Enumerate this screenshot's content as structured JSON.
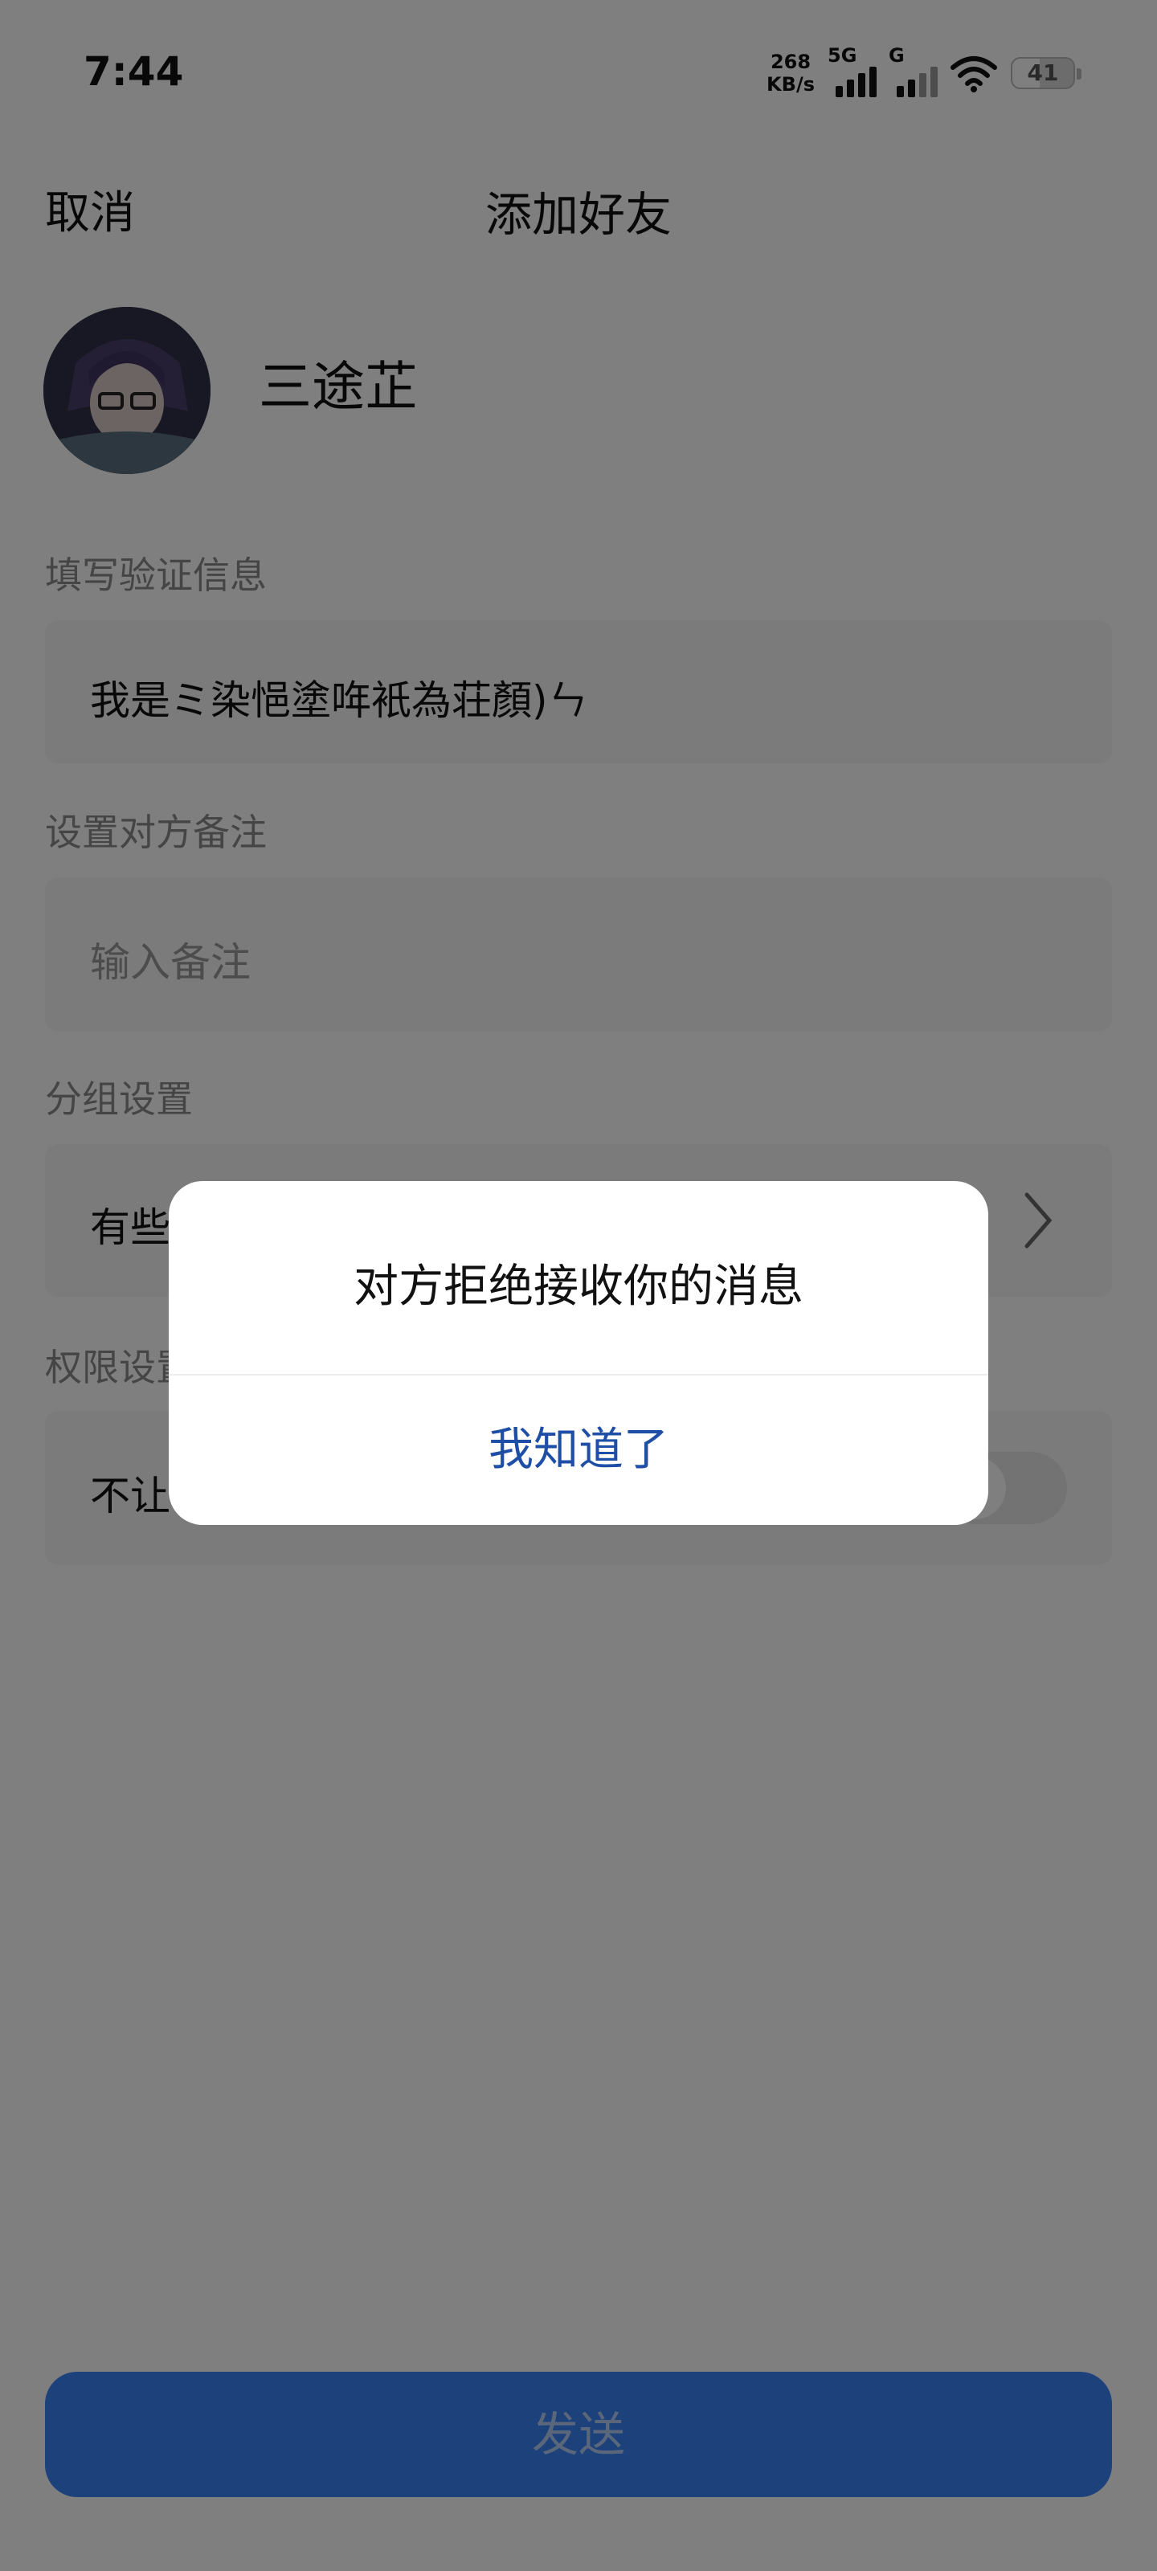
{
  "status_bar": {
    "time": "7:44",
    "net_speed_value": "268",
    "net_speed_unit": "KB/s",
    "sim1_label": "5G",
    "sim2_label": "G",
    "battery_level": "41"
  },
  "nav": {
    "cancel_label": "取消",
    "title": "添加好友"
  },
  "profile": {
    "name": "三途芷"
  },
  "verify": {
    "label": "填写验证信息",
    "value": "我是ミ染悒塗哖衹為荘顏)ㄣ"
  },
  "remark": {
    "label": "设置对方备注",
    "placeholder": "输入备注"
  },
  "group": {
    "label": "分组设置",
    "value": "有些"
  },
  "permission": {
    "label": "权限设置",
    "row_text": "不让"
  },
  "send_button": {
    "label": "发送"
  },
  "dialog": {
    "message": "对方拒绝接收你的消息",
    "button_label": "我知道了"
  },
  "colors": {
    "accent": "#3b82f6",
    "dialog_button": "#1f4ea6",
    "overlay": "rgba(0,0,0,0.50)"
  },
  "icons": [
    "wifi-icon",
    "signal-icon",
    "battery-icon",
    "chevron-right-icon"
  ]
}
